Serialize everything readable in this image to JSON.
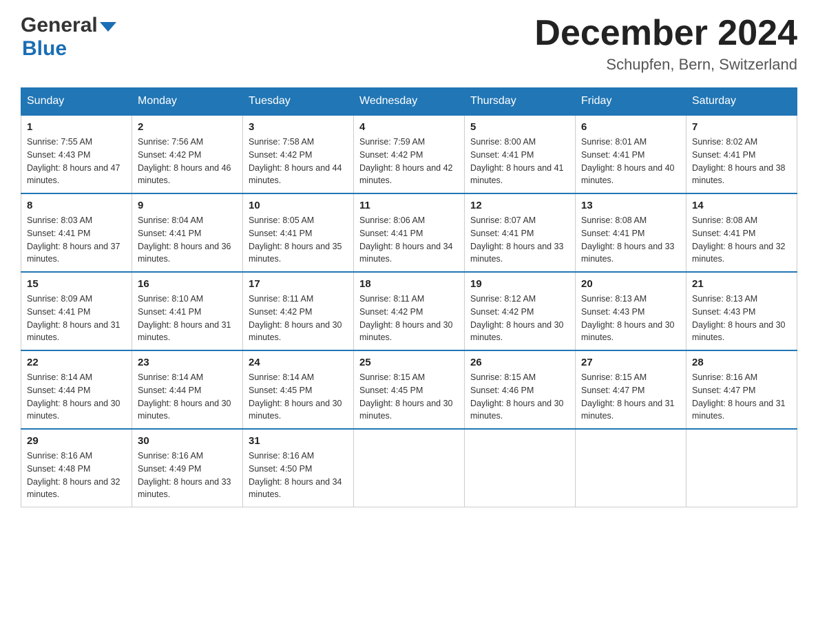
{
  "header": {
    "logo_general": "General",
    "logo_blue": "Blue",
    "month_title": "December 2024",
    "location": "Schupfen, Bern, Switzerland"
  },
  "days_of_week": [
    "Sunday",
    "Monday",
    "Tuesday",
    "Wednesday",
    "Thursday",
    "Friday",
    "Saturday"
  ],
  "weeks": [
    [
      {
        "day": "1",
        "sunrise": "7:55 AM",
        "sunset": "4:43 PM",
        "daylight": "8 hours and 47 minutes."
      },
      {
        "day": "2",
        "sunrise": "7:56 AM",
        "sunset": "4:42 PM",
        "daylight": "8 hours and 46 minutes."
      },
      {
        "day": "3",
        "sunrise": "7:58 AM",
        "sunset": "4:42 PM",
        "daylight": "8 hours and 44 minutes."
      },
      {
        "day": "4",
        "sunrise": "7:59 AM",
        "sunset": "4:42 PM",
        "daylight": "8 hours and 42 minutes."
      },
      {
        "day": "5",
        "sunrise": "8:00 AM",
        "sunset": "4:41 PM",
        "daylight": "8 hours and 41 minutes."
      },
      {
        "day": "6",
        "sunrise": "8:01 AM",
        "sunset": "4:41 PM",
        "daylight": "8 hours and 40 minutes."
      },
      {
        "day": "7",
        "sunrise": "8:02 AM",
        "sunset": "4:41 PM",
        "daylight": "8 hours and 38 minutes."
      }
    ],
    [
      {
        "day": "8",
        "sunrise": "8:03 AM",
        "sunset": "4:41 PM",
        "daylight": "8 hours and 37 minutes."
      },
      {
        "day": "9",
        "sunrise": "8:04 AM",
        "sunset": "4:41 PM",
        "daylight": "8 hours and 36 minutes."
      },
      {
        "day": "10",
        "sunrise": "8:05 AM",
        "sunset": "4:41 PM",
        "daylight": "8 hours and 35 minutes."
      },
      {
        "day": "11",
        "sunrise": "8:06 AM",
        "sunset": "4:41 PM",
        "daylight": "8 hours and 34 minutes."
      },
      {
        "day": "12",
        "sunrise": "8:07 AM",
        "sunset": "4:41 PM",
        "daylight": "8 hours and 33 minutes."
      },
      {
        "day": "13",
        "sunrise": "8:08 AM",
        "sunset": "4:41 PM",
        "daylight": "8 hours and 33 minutes."
      },
      {
        "day": "14",
        "sunrise": "8:08 AM",
        "sunset": "4:41 PM",
        "daylight": "8 hours and 32 minutes."
      }
    ],
    [
      {
        "day": "15",
        "sunrise": "8:09 AM",
        "sunset": "4:41 PM",
        "daylight": "8 hours and 31 minutes."
      },
      {
        "day": "16",
        "sunrise": "8:10 AM",
        "sunset": "4:41 PM",
        "daylight": "8 hours and 31 minutes."
      },
      {
        "day": "17",
        "sunrise": "8:11 AM",
        "sunset": "4:42 PM",
        "daylight": "8 hours and 30 minutes."
      },
      {
        "day": "18",
        "sunrise": "8:11 AM",
        "sunset": "4:42 PM",
        "daylight": "8 hours and 30 minutes."
      },
      {
        "day": "19",
        "sunrise": "8:12 AM",
        "sunset": "4:42 PM",
        "daylight": "8 hours and 30 minutes."
      },
      {
        "day": "20",
        "sunrise": "8:13 AM",
        "sunset": "4:43 PM",
        "daylight": "8 hours and 30 minutes."
      },
      {
        "day": "21",
        "sunrise": "8:13 AM",
        "sunset": "4:43 PM",
        "daylight": "8 hours and 30 minutes."
      }
    ],
    [
      {
        "day": "22",
        "sunrise": "8:14 AM",
        "sunset": "4:44 PM",
        "daylight": "8 hours and 30 minutes."
      },
      {
        "day": "23",
        "sunrise": "8:14 AM",
        "sunset": "4:44 PM",
        "daylight": "8 hours and 30 minutes."
      },
      {
        "day": "24",
        "sunrise": "8:14 AM",
        "sunset": "4:45 PM",
        "daylight": "8 hours and 30 minutes."
      },
      {
        "day": "25",
        "sunrise": "8:15 AM",
        "sunset": "4:45 PM",
        "daylight": "8 hours and 30 minutes."
      },
      {
        "day": "26",
        "sunrise": "8:15 AM",
        "sunset": "4:46 PM",
        "daylight": "8 hours and 30 minutes."
      },
      {
        "day": "27",
        "sunrise": "8:15 AM",
        "sunset": "4:47 PM",
        "daylight": "8 hours and 31 minutes."
      },
      {
        "day": "28",
        "sunrise": "8:16 AM",
        "sunset": "4:47 PM",
        "daylight": "8 hours and 31 minutes."
      }
    ],
    [
      {
        "day": "29",
        "sunrise": "8:16 AM",
        "sunset": "4:48 PM",
        "daylight": "8 hours and 32 minutes."
      },
      {
        "day": "30",
        "sunrise": "8:16 AM",
        "sunset": "4:49 PM",
        "daylight": "8 hours and 33 minutes."
      },
      {
        "day": "31",
        "sunrise": "8:16 AM",
        "sunset": "4:50 PM",
        "daylight": "8 hours and 34 minutes."
      },
      null,
      null,
      null,
      null
    ]
  ]
}
